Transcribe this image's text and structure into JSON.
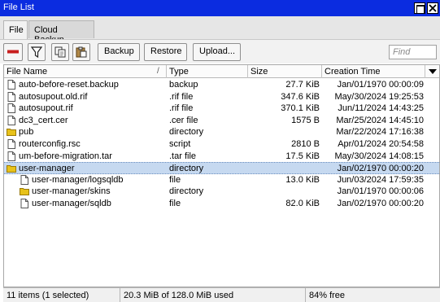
{
  "window": {
    "title": "File List"
  },
  "tabs": [
    {
      "label": "File",
      "active": true
    },
    {
      "label": "Cloud Backup",
      "active": false
    }
  ],
  "toolbar": {
    "remove_icon": "remove-icon",
    "filter_icon": "filter-icon",
    "copy_icon": "copy-icon",
    "paste_icon": "paste-icon",
    "backup_label": "Backup",
    "restore_label": "Restore",
    "upload_label": "Upload...",
    "find_placeholder": "Find"
  },
  "table": {
    "columns": [
      "File Name",
      "Type",
      "Size",
      "Creation Time"
    ],
    "sort_indicator": "/",
    "rows": [
      {
        "name": "auto-before-reset.backup",
        "type": "backup",
        "size": "27.7 KiB",
        "created": "Jan/01/1970 00:00:09",
        "icon": "file-icon",
        "child": false,
        "selected": false
      },
      {
        "name": "autosupout.old.rif",
        "type": ".rif file",
        "size": "347.6 KiB",
        "created": "May/30/2024 19:25:53",
        "icon": "file-icon",
        "child": false,
        "selected": false
      },
      {
        "name": "autosupout.rif",
        "type": ".rif file",
        "size": "370.1 KiB",
        "created": "Jun/11/2024 14:43:25",
        "icon": "file-icon",
        "child": false,
        "selected": false
      },
      {
        "name": "dc3_cert.cer",
        "type": ".cer file",
        "size": "1575 B",
        "created": "Mar/25/2024 14:45:10",
        "icon": "file-icon",
        "child": false,
        "selected": false
      },
      {
        "name": "pub",
        "type": "directory",
        "size": "",
        "created": "Mar/22/2024 17:16:38",
        "icon": "folder-icon",
        "child": false,
        "selected": false
      },
      {
        "name": "routerconfig.rsc",
        "type": "script",
        "size": "2810 B",
        "created": "Apr/01/2024 20:54:58",
        "icon": "file-icon",
        "child": false,
        "selected": false
      },
      {
        "name": "um-before-migration.tar",
        "type": ".tar file",
        "size": "17.5 KiB",
        "created": "May/30/2024 14:08:15",
        "icon": "file-icon",
        "child": false,
        "selected": false
      },
      {
        "name": "user-manager",
        "type": "directory",
        "size": "",
        "created": "Jan/02/1970 00:00:20",
        "icon": "folder-icon",
        "child": false,
        "selected": true
      },
      {
        "name": "user-manager/logsqldb",
        "type": "file",
        "size": "13.0 KiB",
        "created": "Jun/03/2024 17:59:35",
        "icon": "file-icon",
        "child": true,
        "selected": false
      },
      {
        "name": "user-manager/skins",
        "type": "directory",
        "size": "",
        "created": "Jan/01/1970 00:00:06",
        "icon": "folder-icon",
        "child": true,
        "selected": false
      },
      {
        "name": "user-manager/sqldb",
        "type": "file",
        "size": "82.0 KiB",
        "created": "Jan/02/1970 00:00:20",
        "icon": "file-icon",
        "child": true,
        "selected": false
      }
    ]
  },
  "status": {
    "count": "11 items (1 selected)",
    "used": "20.3 MiB of 128.0 MiB used",
    "free": "84% free"
  },
  "colors": {
    "titlebar": "#0b2ce0",
    "selection": "#c6d9f0",
    "folder": "#e8c21a",
    "remove": "#c81e1e"
  }
}
